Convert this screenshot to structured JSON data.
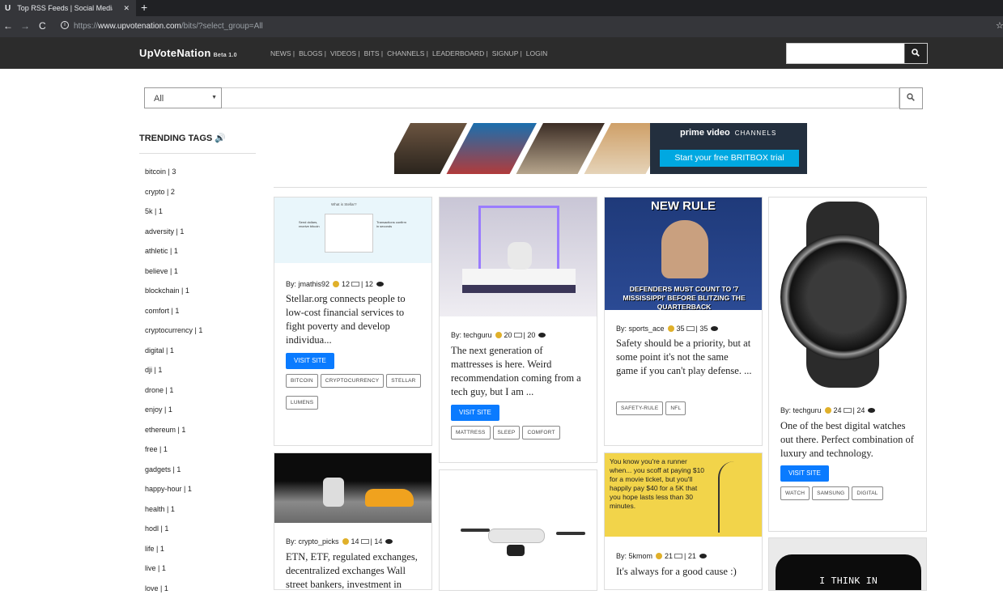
{
  "browser": {
    "tab_favicon": "U",
    "tab_title": "Top RSS Feeds | Social Media Blo",
    "tab_close": "✕",
    "new_tab": "+",
    "back": "←",
    "forward": "→",
    "reload": "C",
    "url_prefix": "https://",
    "url_host": "www.upvotenation.com",
    "url_path": "/bits/?select_group=All",
    "star": "☆"
  },
  "header": {
    "logo": "UpVoteNation",
    "badge": "Beta 1.0",
    "menu": [
      "NEWS |",
      "BLOGS |",
      "VIDEOS |",
      "BITS |",
      "CHANNELS |",
      "LEADERBOARD |",
      "SIGNUP |",
      "LOGIN"
    ],
    "search_placeholder": ""
  },
  "filter": {
    "selected": "All",
    "search_placeholder": ""
  },
  "sidebar": {
    "title": "TRENDING TAGS",
    "tags": [
      "bitcoin | 3",
      "crypto | 2",
      "5k | 1",
      "adversity | 1",
      "athletic | 1",
      "believe | 1",
      "blockchain | 1",
      "comfort | 1",
      "cryptocurrency | 1",
      "digital | 1",
      "dji | 1",
      "drone | 1",
      "enjoy | 1",
      "ethereum | 1",
      "free | 1",
      "gadgets | 1",
      "happy-hour | 1",
      "health | 1",
      "hodl | 1",
      "life | 1",
      "live | 1",
      "love | 1"
    ]
  },
  "banner": {
    "brand": "prime video",
    "channels": "CHANNELS",
    "cta": "Start your free BRITBOX trial"
  },
  "cards": [
    {
      "author": "By: jmathis92",
      "votes": "12",
      "sep": "|",
      "views": "12",
      "desc": "Stellar.org connects people to low-cost financial services to fight poverty and develop individua...",
      "visit": "VISIT SITE",
      "tags": [
        "BITCOIN",
        "CRYPTOCURRENCY",
        "STELLAR",
        "LUMENS"
      ],
      "img_title": "What is Stellar?",
      "img_left": "Send dollars, receive bitcoin",
      "img_right": "Transactions confirm in seconds"
    },
    {
      "author": "By: techguru",
      "votes": "20",
      "sep": "|",
      "views": "20",
      "desc": "The next generation of mattresses is here. Weird recommendation coming from a tech guy, but I am ...",
      "visit": "VISIT SITE",
      "tags": [
        "MATTRESS",
        "SLEEP",
        "COMFORT"
      ]
    },
    {
      "author": "By: sports_ace",
      "votes": "35",
      "sep": "|",
      "views": "35",
      "desc": "Safety should be a priority, but at some point it's not the same game if you can't play defense. ...",
      "tags": [
        "SAFETY-RULE",
        "NFL"
      ],
      "img_top": "NEW RULE",
      "img_bottom": "DEFENDERS MUST COUNT TO '7 MISSISSIPPI' BEFORE BLITZING THE QUARTERBACK"
    },
    {
      "author": "By: techguru",
      "votes": "24",
      "sep": "|",
      "views": "24",
      "desc": "One of the best digital watches out there. Perfect combination of luxury and technology.",
      "visit": "VISIT SITE",
      "tags": [
        "WATCH",
        "SAMSUNG",
        "DIGITAL"
      ]
    },
    {
      "author": "By: crypto_picks",
      "votes": "14",
      "sep": "|",
      "views": "14",
      "desc": "ETN, ETF, regulated exchanges, decentralized exchanges Wall street bankers, investment in"
    },
    {
      "author": "By: 5kmom",
      "votes": "21",
      "sep": "|",
      "views": "21",
      "desc": "It's always for a good cause :)",
      "img_text": "You know you're a runner when... you scoff at paying $10 for a movie ticket, but you'll happily pay $40 for a 5K that you hope lasts less than 30 minutes."
    },
    {
      "img_text": "I THINK IN"
    }
  ],
  "colors": {
    "nav": "#2c2c2c",
    "primary": "#0a7bff",
    "coin": "#e0b02a"
  }
}
